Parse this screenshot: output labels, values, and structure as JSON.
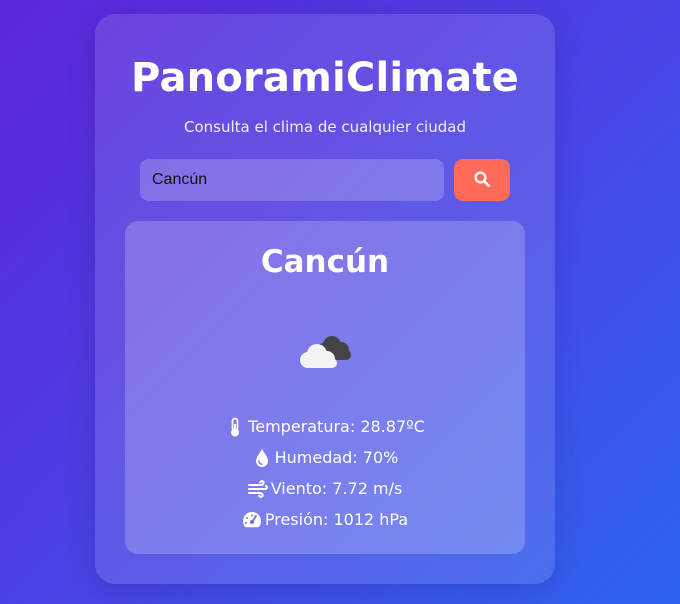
{
  "app": {
    "title": "PanoramiClimate",
    "subtitle": "Consulta el clima de cualquier ciudad"
  },
  "search": {
    "value": "Cancún",
    "button_icon": "search-icon"
  },
  "weather": {
    "city": "Cancún",
    "condition_icon": "cloudy-icon",
    "metrics": [
      {
        "icon": "thermometer-icon",
        "text": "Temperatura: 28.87ºC"
      },
      {
        "icon": "droplet-icon",
        "text": "Humedad: 70%"
      },
      {
        "icon": "wind-icon",
        "text": "Viento: 7.72 m/s"
      },
      {
        "icon": "gauge-icon",
        "text": "Presión: 1012 hPa"
      }
    ]
  },
  "colors": {
    "background_start": "#5b25d8",
    "background_end": "#2d64ee",
    "button": "#ff6b57",
    "text": "#ffffff"
  }
}
